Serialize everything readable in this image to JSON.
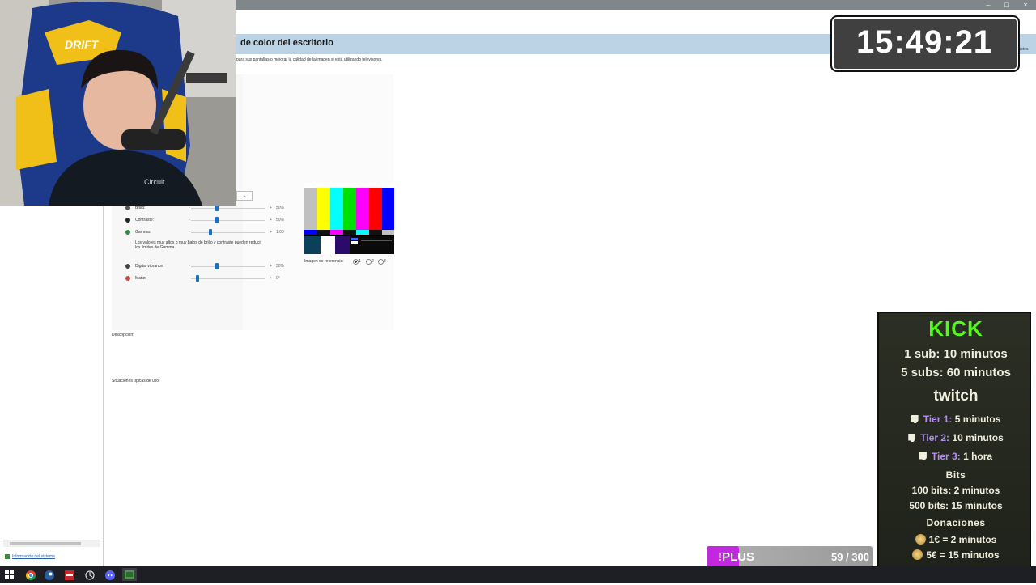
{
  "window": {
    "page_title": "de color del escritorio",
    "subtitle": "para sus pantallas o mejorar la calidad de la imagen si está utilizando televisores.",
    "top_right_link": "Ajustes",
    "controls": {
      "minimize": "–",
      "maximize": "□",
      "close": "×"
    }
  },
  "panel": {
    "sliders": [
      {
        "name": "Brillo:",
        "value": "50%",
        "icon_color": "#555555"
      },
      {
        "name": "Contraste:",
        "value": "50%",
        "icon_color": "#222222"
      },
      {
        "name": "Gamma:",
        "value": "1.00",
        "icon_color": "#2e8b3a"
      },
      {
        "name": "Digital vibrance:",
        "value": "50%",
        "icon_color": "#444444"
      },
      {
        "name": "Matiz:",
        "value": "0°",
        "icon_color": "#d04848"
      }
    ],
    "slider_levels": [
      0.5,
      0.5,
      0.33,
      0.5,
      0.0
    ],
    "minus": "-",
    "plus": "+",
    "gamma_warning": "Los valores muy altos o muy bajos de brillo y contraste pueden reducir los límites de Gamma.",
    "reference_label": "Imagen de referencia:",
    "reference_options": [
      "1",
      "2",
      "3"
    ],
    "reference_selected": "1",
    "description_label": "Descripción:",
    "typical_uses_label": "Situaciones típicas de uso:"
  },
  "sidebar": {
    "system_info_link": "Información del sistema"
  },
  "overlay": {
    "clock": "15:49:21",
    "kick_logo": "KICK",
    "kick_lines": [
      "1 sub: 10 minutos",
      "5 subs: 60 minutos"
    ],
    "twitch_logo": "twitch",
    "twitch_tiers": [
      {
        "tier": "Tier 1:",
        "reward": "5 minutos"
      },
      {
        "tier": "Tier 2:",
        "reward": "10 minutos"
      },
      {
        "tier": "Tier 3:",
        "reward": "1 hora"
      }
    ],
    "bits_header": "Bits",
    "bits_lines": [
      "100 bits: 2 minutos",
      "500 bits: 15 minutos"
    ],
    "donations_header": "Donaciones",
    "donation_lines": [
      "1€ = 2 minutos",
      "5€ = 15 minutos"
    ],
    "plus_label": "!PLUS",
    "plus_count": "59 / 300",
    "plus_progress": 0.197
  },
  "colors": {
    "kick_green": "#53fc18",
    "twitch_purple": "#b48ef0",
    "plus_magenta": "#c228e0",
    "header_blue": "#bcd3e6",
    "slider_blue": "#1f6fc0"
  },
  "taskbar": {
    "icons": [
      "windows-start-icon",
      "chrome-icon",
      "steam-icon",
      "app-red-icon",
      "browser-icon",
      "discord-icon",
      "game-icon"
    ]
  }
}
